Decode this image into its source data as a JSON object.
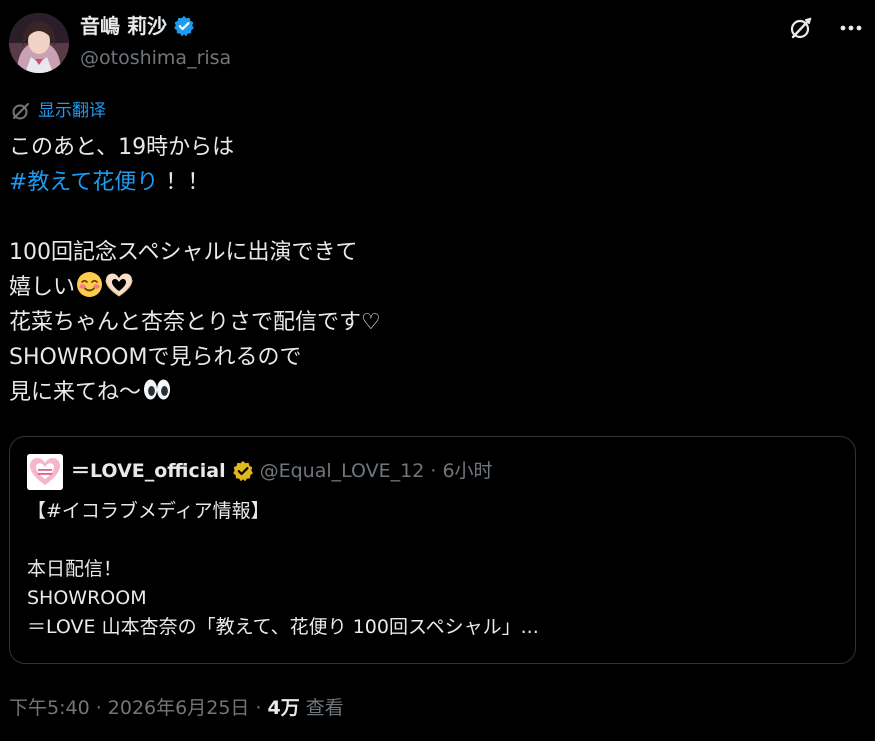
{
  "author": {
    "display_name": "音嶋 莉沙",
    "handle": "@otoshima_risa",
    "verified_icon": "blue-verified-badge-icon",
    "avatar_icon": "profile-photo-avatar"
  },
  "header_actions": {
    "grok_icon": "grok-slash-circle-icon",
    "more_icon": "more-dots-icon"
  },
  "translate": {
    "icon": "grok-translate-icon",
    "label": "显示翻译"
  },
  "tweet": {
    "line1": "このあと、19時からは",
    "hashtag": "#教えて花便り",
    "line2_suffix": " ！！",
    "line3": "",
    "line4": "100回記念スペシャルに出演できて",
    "line5": "嬉しい",
    "line5_emojis": [
      "smiling-face-blushing-icon",
      "heart-hands-icon"
    ],
    "line6": "花菜ちゃんと杏奈とりさで配信です♡",
    "line7": "SHOWROOMで見られるので",
    "line8": "見に来てね〜",
    "line8_emoji": "eyes-icon"
  },
  "quote": {
    "avatar_icon": "equal-love-logo-avatar",
    "name": "＝LOVE_official",
    "verified_icon": "gold-verified-badge-icon",
    "meta": "@Equal_LOVE_12 · 6小时",
    "line1": "【#イコラブメディア情報】",
    "line2": "",
    "line3": "本日配信！",
    "line4": "SHOWROOM",
    "line5": "＝LOVE 山本杏奈の「教えて、花便り 100回スペシャル」..."
  },
  "meta": {
    "time_date": "下午5:40 · 2026年6月25日 · ",
    "views_count": "4万",
    "views_label": " 查看"
  },
  "colors": {
    "background": "#000000",
    "text": "#e7e9ea",
    "secondary": "#71767b",
    "accent": "#1d9bf0",
    "border": "#2f3336",
    "gold": "#e2b719"
  }
}
